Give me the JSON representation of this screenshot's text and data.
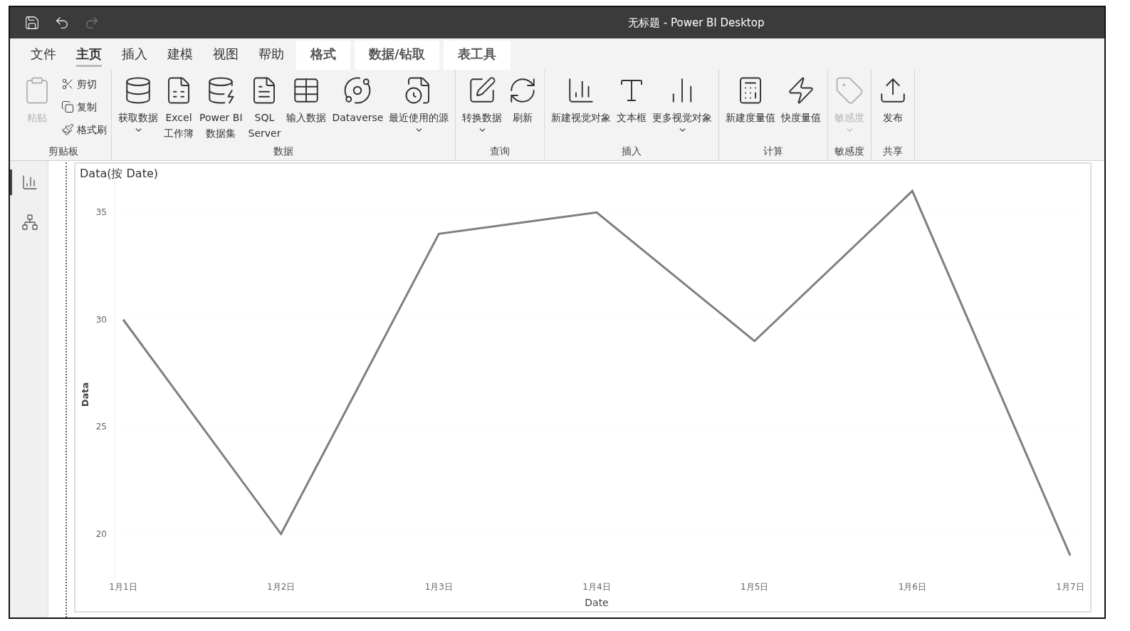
{
  "window": {
    "title": "无标题 - Power BI Desktop"
  },
  "quick_access": [
    {
      "disabled": false
    },
    {
      "disabled": false
    },
    {
      "disabled": true
    }
  ],
  "tabs": [
    {
      "label": "文件",
      "selected": false,
      "contextual": false
    },
    {
      "label": "主页",
      "selected": true,
      "contextual": false
    },
    {
      "label": "插入",
      "selected": false,
      "contextual": false
    },
    {
      "label": "建模",
      "selected": false,
      "contextual": false
    },
    {
      "label": "视图",
      "selected": false,
      "contextual": false
    },
    {
      "label": "帮助",
      "selected": false,
      "contextual": false
    },
    {
      "label": "格式",
      "selected": false,
      "contextual": true
    },
    {
      "label": "数据/钻取",
      "selected": false,
      "contextual": true
    },
    {
      "label": "表工具",
      "selected": false,
      "contextual": true
    }
  ],
  "ribbon_groups": [
    {
      "label": "剪贴板",
      "items": [
        {
          "kind": "large",
          "lines": [
            "粘贴"
          ],
          "disabled": true,
          "dropdown": false
        },
        {
          "kind": "small",
          "lines": [
            "剪切"
          ],
          "disabled": false,
          "dropdown": false
        },
        {
          "kind": "small",
          "lines": [
            "复制"
          ],
          "disabled": false,
          "dropdown": false
        },
        {
          "kind": "small",
          "lines": [
            "格式刷"
          ],
          "disabled": false,
          "dropdown": false
        }
      ]
    },
    {
      "label": "数据",
      "items": [
        {
          "kind": "large",
          "lines": [
            "获取数据"
          ],
          "disabled": false,
          "dropdown": true
        },
        {
          "kind": "large",
          "lines": [
            "Excel",
            "工作簿"
          ],
          "disabled": false,
          "dropdown": false
        },
        {
          "kind": "large",
          "lines": [
            "Power BI",
            "数据集"
          ],
          "disabled": false,
          "dropdown": false
        },
        {
          "kind": "large",
          "lines": [
            "SQL",
            "Server"
          ],
          "disabled": false,
          "dropdown": false
        },
        {
          "kind": "large",
          "lines": [
            "输入数据"
          ],
          "disabled": false,
          "dropdown": false
        },
        {
          "kind": "large",
          "lines": [
            "Dataverse"
          ],
          "disabled": false,
          "dropdown": false
        },
        {
          "kind": "large",
          "lines": [
            "最近使用的源"
          ],
          "disabled": false,
          "dropdown": true
        }
      ]
    },
    {
      "label": "查询",
      "items": [
        {
          "kind": "large",
          "lines": [
            "转换数据"
          ],
          "disabled": false,
          "dropdown": true
        },
        {
          "kind": "large",
          "lines": [
            "刷新"
          ],
          "disabled": false,
          "dropdown": false
        }
      ]
    },
    {
      "label": "插入",
      "items": [
        {
          "kind": "large",
          "lines": [
            "新建视觉对象"
          ],
          "disabled": false,
          "dropdown": false
        },
        {
          "kind": "large",
          "lines": [
            "文本框"
          ],
          "disabled": false,
          "dropdown": false
        },
        {
          "kind": "large",
          "lines": [
            "更多视觉对象"
          ],
          "disabled": false,
          "dropdown": true
        }
      ]
    },
    {
      "label": "计算",
      "items": [
        {
          "kind": "large",
          "lines": [
            "新建度量值"
          ],
          "disabled": false,
          "dropdown": false
        },
        {
          "kind": "large",
          "lines": [
            "快度量值"
          ],
          "disabled": false,
          "dropdown": false
        }
      ]
    },
    {
      "label": "敏感度",
      "items": [
        {
          "kind": "large",
          "lines": [
            "敏感度"
          ],
          "disabled": true,
          "dropdown": true
        }
      ]
    },
    {
      "label": "共享",
      "items": [
        {
          "kind": "large",
          "lines": [
            "发布"
          ],
          "disabled": false,
          "dropdown": false
        }
      ]
    }
  ],
  "side_nav": [
    {
      "selected": true
    },
    {
      "selected": false
    }
  ],
  "visual": {
    "title": "Data(按 Date)",
    "chart_data": {
      "type": "line",
      "xlabel": "Date",
      "ylabel": "Data",
      "categories": [
        "1月1日",
        "1月2日",
        "1月3日",
        "1月4日",
        "1月5日",
        "1月6日",
        "1月7日"
      ],
      "series": [
        {
          "color": "#7f7f7f",
          "values": [
            30,
            20,
            34,
            35,
            29,
            36,
            19
          ]
        }
      ],
      "ylim": [
        17.9,
        37.2
      ],
      "yticks": [
        20,
        25,
        30,
        35
      ],
      "grid": true
    }
  }
}
